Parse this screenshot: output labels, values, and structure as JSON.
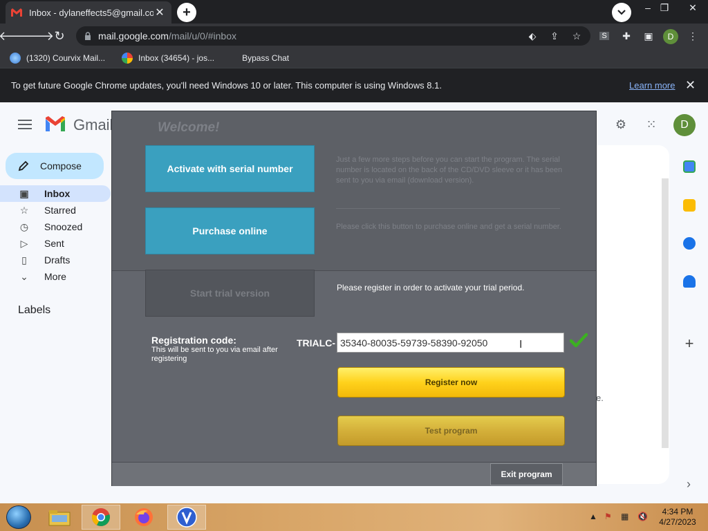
{
  "browser": {
    "tab_title": "Inbox - dylaneffects5@gmail.com",
    "new_tab": "+",
    "url_host": "mail.google.com",
    "url_path": "/mail/u/0/#inbox",
    "profile_initial": "D",
    "bookmarks": [
      {
        "label": "(1320) Courvix Mail..."
      },
      {
        "label": "Inbox (34654) - jos..."
      },
      {
        "label": "Bypass Chat"
      }
    ],
    "infobar": {
      "message": "To get future Google Chrome updates, you'll need Windows 10 or later. This computer is using Windows 8.1.",
      "link": "Learn more"
    }
  },
  "gmail": {
    "brand": "Gmail",
    "compose": "Compose",
    "nav": [
      {
        "label": "Inbox",
        "active": true
      },
      {
        "label": "Starred"
      },
      {
        "label": "Snoozed"
      },
      {
        "label": "Sent"
      },
      {
        "label": "Drafts"
      },
      {
        "label": "More"
      }
    ],
    "labels_heading": "Labels",
    "avatar_initial": "D",
    "clipped_text": "e."
  },
  "dialog": {
    "welcome": "Welcome!",
    "activate_button": "Activate with serial number",
    "activate_desc": "Just a few more steps before you can start the program. The serial number is located on the back of the CD/DVD sleeve or it has been sent to you via email (download version).",
    "purchase_button": "Purchase online",
    "purchase_desc": "Please click this button to purchase online and get a serial number.",
    "trial_button": "Start trial version",
    "trial_message": "Please register in order to activate your trial period.",
    "registration_label": "Registration code:",
    "registration_sub": "This will be sent to you via email after registering",
    "code_prefix": "TRIALC-",
    "code_value": "35340-80035-59739-58390-92050",
    "register_button": "Register now",
    "test_button": "Test program",
    "exit_button": "Exit program"
  },
  "taskbar": {
    "time": "4:34 PM",
    "date": "4/27/2023"
  },
  "colors": {
    "accent_blue": "#3aa0bf",
    "register_yellow": "#ffd21c",
    "check_green": "#3cb021"
  }
}
